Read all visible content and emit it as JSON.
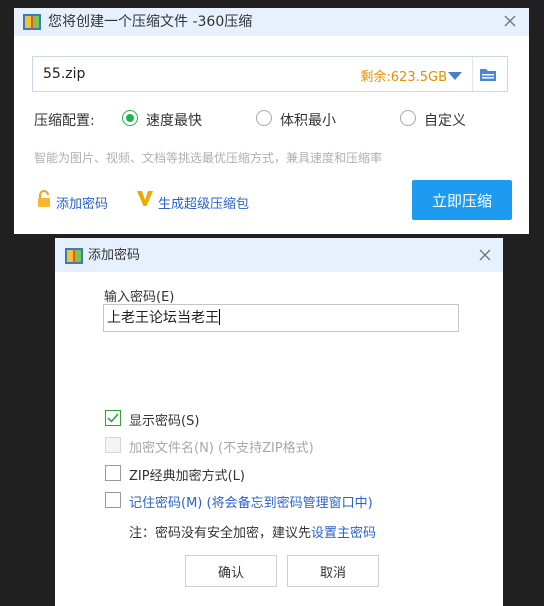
{
  "compress_window": {
    "title": "您将创建一个压缩文件 -360压缩",
    "file_name": "55.zip",
    "free_space": "剩余:623.5GB",
    "config_label": "压缩配置:",
    "options": [
      "速度最快",
      "体积最小",
      "自定义"
    ],
    "selected_option": "速度最快",
    "hint": "智能为图片、视频、文档等挑选最优压缩方式，兼具速度和压缩率",
    "add_password": "添加密码",
    "super_package": "生成超级压缩包",
    "compress_button": "立即压缩"
  },
  "password_dialog": {
    "title": "添加密码",
    "input_label": "输入密码(E)",
    "password_value": "上老王论坛当老王",
    "show_password": "显示密码(S)",
    "encrypt_filenames": "加密文件名(N) (不支持ZIP格式)",
    "zip_classic": "ZIP经典加密方式(L)",
    "remember_password": "记住密码(M) (将会备忘到密码管理窗口中)",
    "note_prefix": "注：密码没有安全加密，建议先",
    "note_link": "设置主密码",
    "ok_button": "确认",
    "cancel_button": "取消"
  },
  "colors": {
    "accent_blue": "#1d9bf0",
    "link_blue": "#2a62c9",
    "radio_green": "#26b04e",
    "free_space_orange": "#e09000",
    "titlebar": "#e7f1fd"
  },
  "icons": [
    "archive-app-icon",
    "close-icon",
    "dropdown-arrow-icon",
    "folder-icon",
    "lock-icon",
    "v-badge-icon",
    "checkmark-icon"
  ]
}
